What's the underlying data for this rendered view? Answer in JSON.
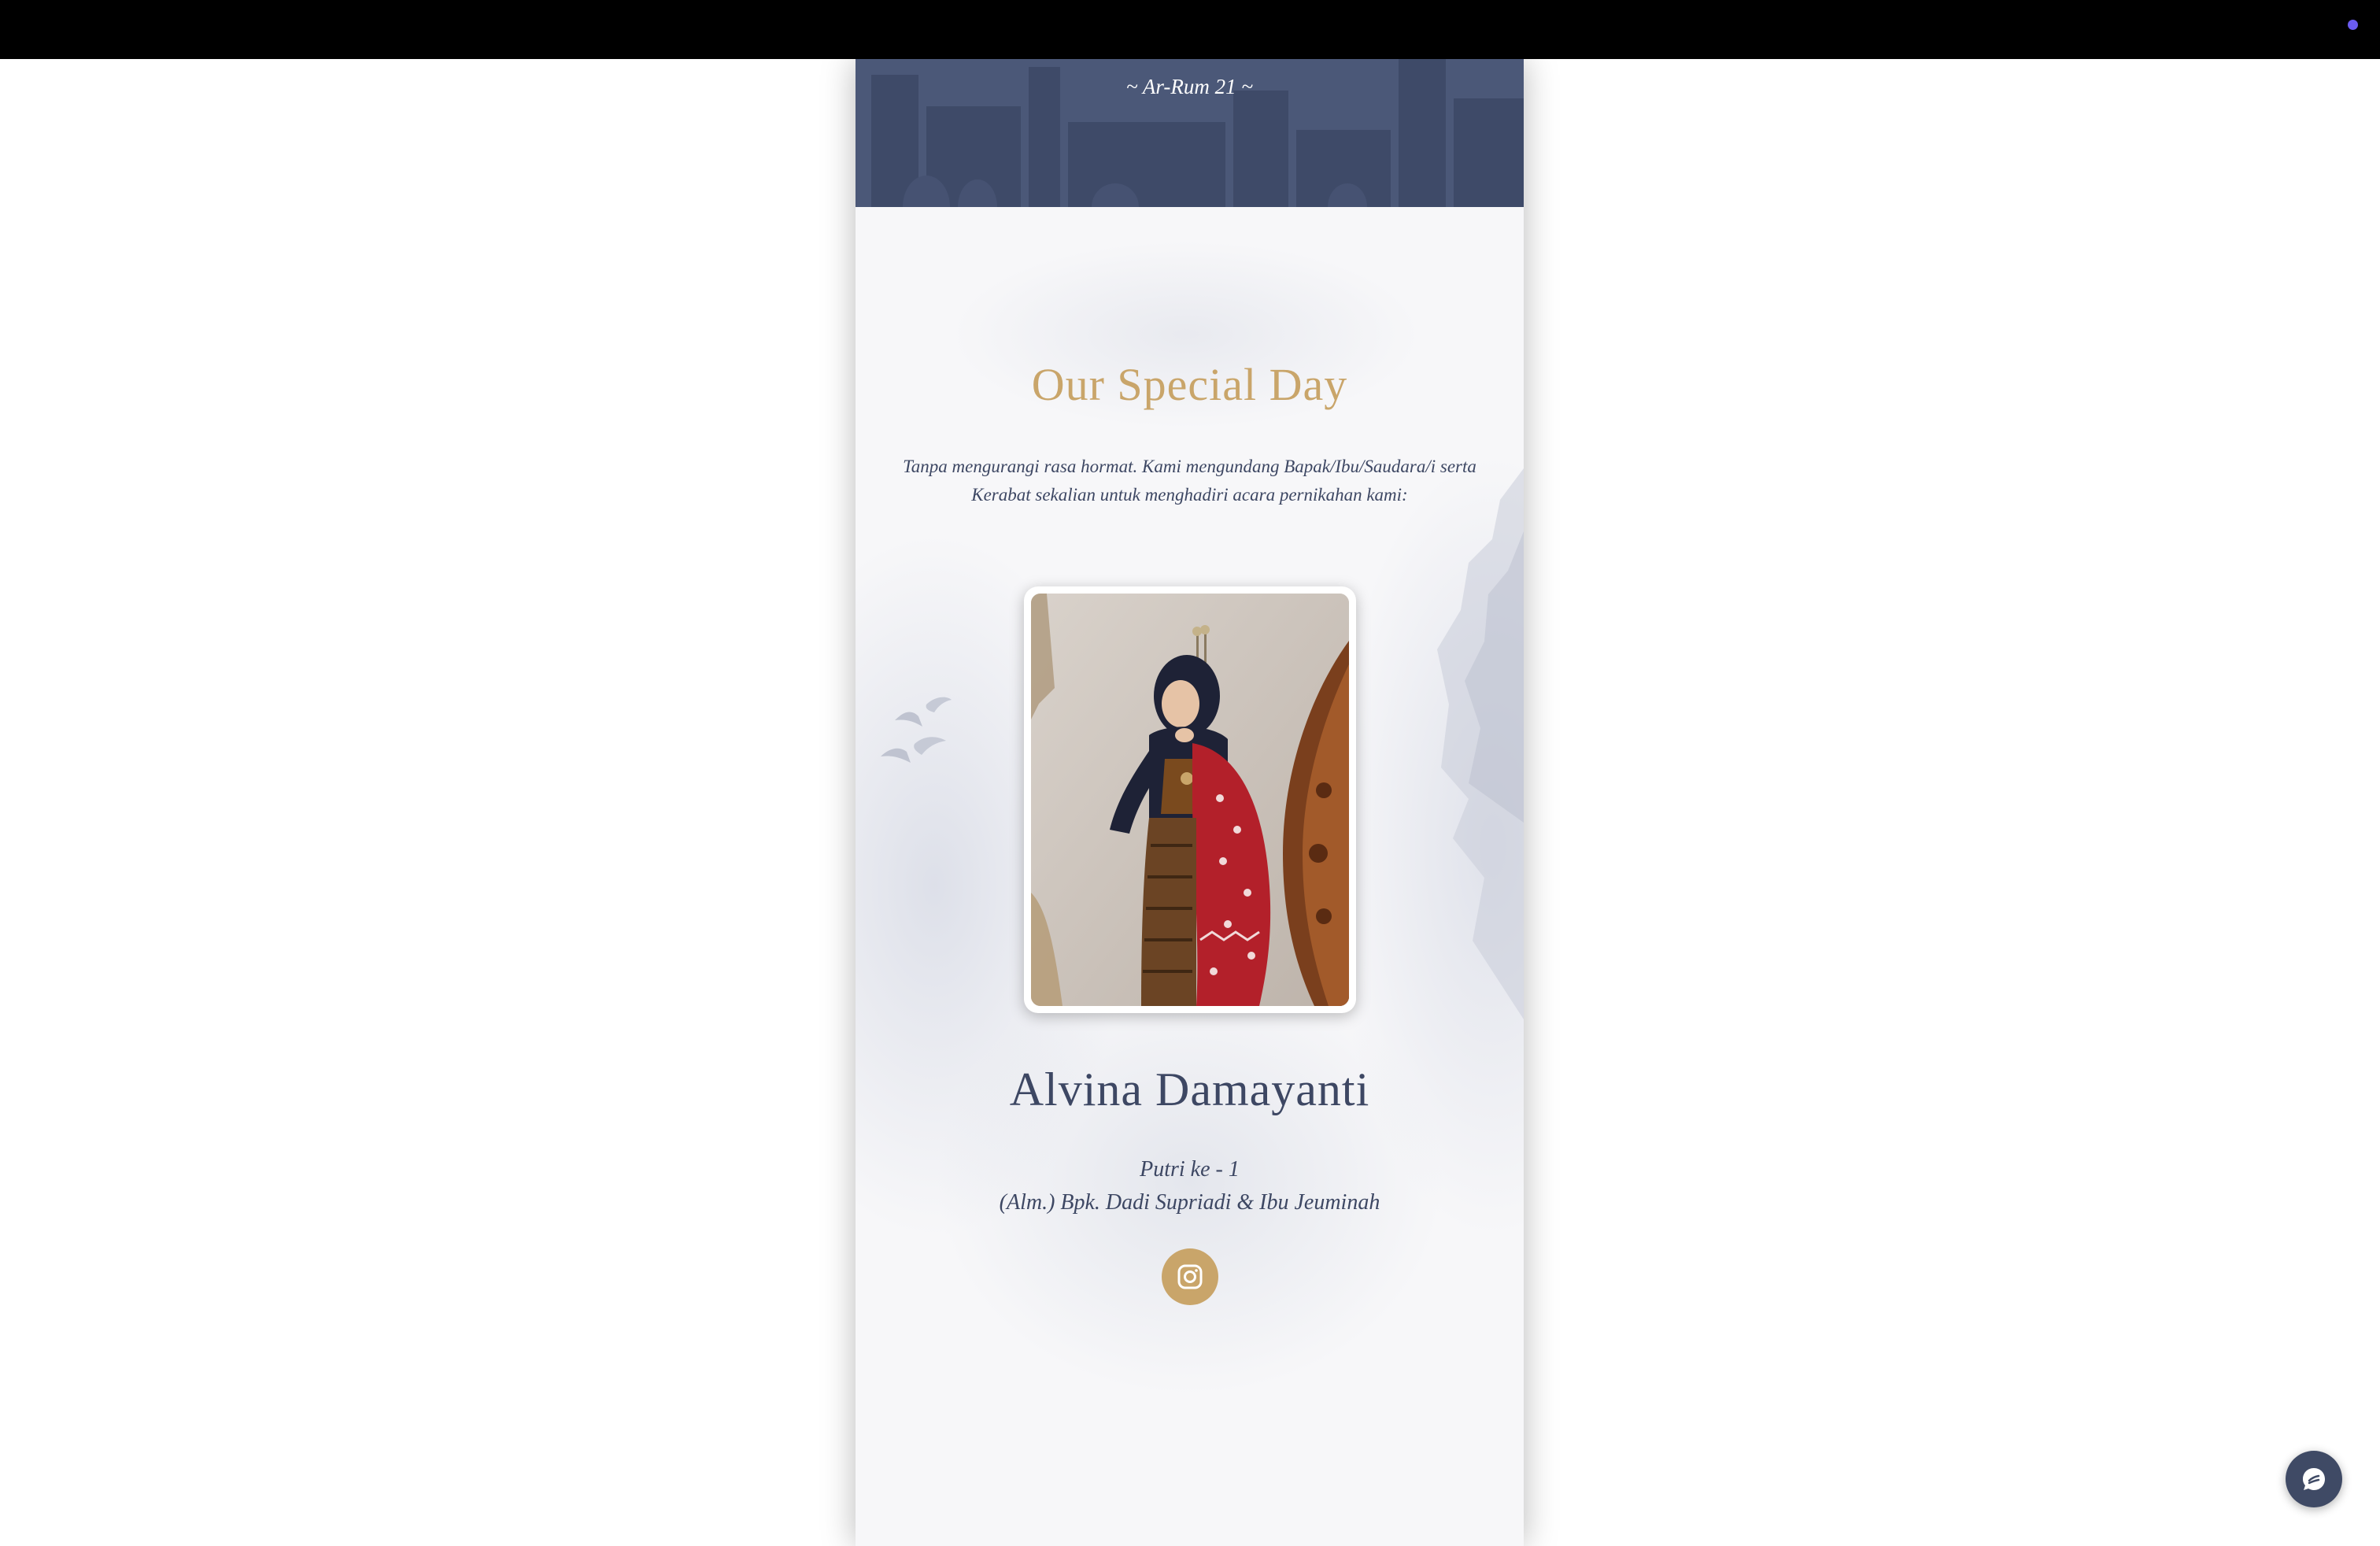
{
  "header": {
    "verse_reference": "~ Ar-Rum 21 ~"
  },
  "section": {
    "title": "Our Special Day",
    "intro": "Tanpa mengurangi rasa hormat. Kami mengundang Bapak/Ibu/Saudara/i serta Kerabat sekalian untuk menghadiri acara pernikahan kami:"
  },
  "bride": {
    "name": "Alvina Damayanti",
    "child_order": "Putri ke - 1",
    "parents": "(Alm.) Bpk. Dadi Supriadi & Ibu Jeuminah",
    "social_icon": "instagram-icon"
  },
  "floating": {
    "chat_icon": "chat-bubble-icon"
  },
  "colors": {
    "accent_gold": "#c9a56a",
    "navy_text": "#3d4763",
    "header_band": "#4b5878",
    "top_bar": "#000000",
    "chat_button": "#3f4a65",
    "status_dot": "#6b5cf0"
  }
}
